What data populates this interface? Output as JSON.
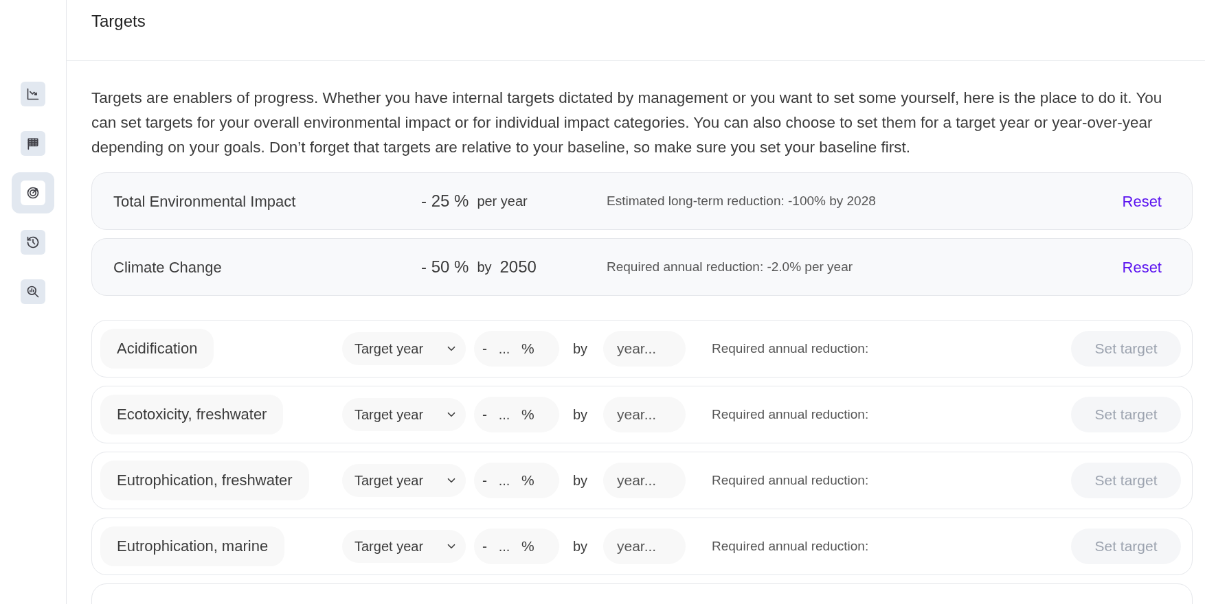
{
  "nav": [
    {
      "selected": false
    },
    {
      "selected": false
    },
    {
      "selected": true
    },
    {
      "selected": false
    },
    {
      "selected": false
    }
  ],
  "header": {
    "title": "Targets"
  },
  "intro": "Targets are enablers of progress. Whether you have internal targets dictated by management or you want to set some yourself, here is the place to do it. You can set targets for your overall environmental impact or for individual impact categories. You can also choose to set them for a target year or year-over-year depending on your goals. Don’t forget that targets are relative to your baseline, so make sure you set your baseline first.",
  "set_targets": [
    {
      "name": "Total Environmental Impact",
      "amount": "- 25 %",
      "connector": "per year",
      "note": "Estimated long-term reduction: -100% by 2028",
      "action": "Reset"
    },
    {
      "name": "Climate Change",
      "amount": "- 50 %",
      "connector": "by",
      "year": "2050",
      "note": "Required annual reduction: -2.0% per year",
      "action": "Reset"
    }
  ],
  "categories": [
    {
      "name": "Acidification",
      "mode": "Target year",
      "sign": "-",
      "amount_placeholder": "...",
      "unit": "%",
      "connector": "by",
      "year_placeholder": "year...",
      "note": "Required annual reduction:",
      "action": "Set target",
      "disabled": true
    },
    {
      "name": "Ecotoxicity, freshwater",
      "mode": "Target year",
      "sign": "-",
      "amount_placeholder": "...",
      "unit": "%",
      "connector": "by",
      "year_placeholder": "year...",
      "note": "Required annual reduction:",
      "action": "Set target",
      "disabled": true
    },
    {
      "name": "Eutrophication, freshwater",
      "mode": "Target year",
      "sign": "-",
      "amount_placeholder": "...",
      "unit": "%",
      "connector": "by",
      "year_placeholder": "year...",
      "note": "Required annual reduction:",
      "action": "Set target",
      "disabled": true
    },
    {
      "name": "Eutrophication, marine",
      "mode": "Target year",
      "sign": "-",
      "amount_placeholder": "...",
      "unit": "%",
      "connector": "by",
      "year_placeholder": "year...",
      "note": "Required annual reduction:",
      "action": "Set target",
      "disabled": true
    }
  ]
}
